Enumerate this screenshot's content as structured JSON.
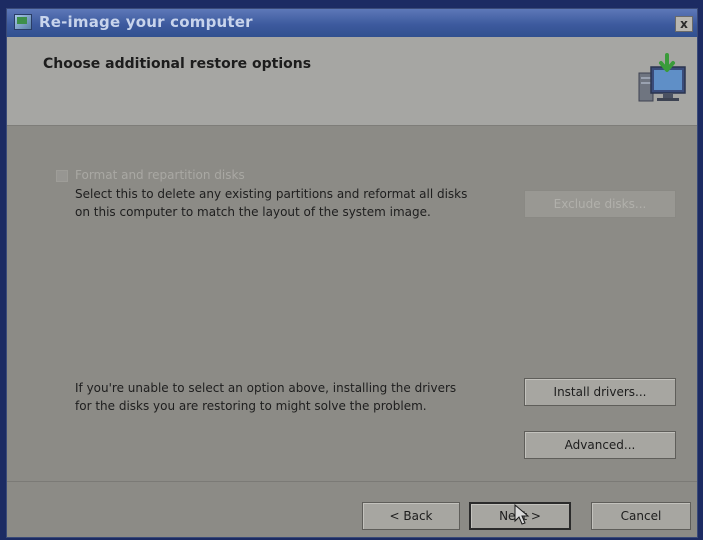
{
  "window": {
    "title": "Re-image your computer",
    "close_glyph": "x"
  },
  "header": {
    "title": "Choose additional restore options",
    "icon": "computer-restore-icon"
  },
  "format_option": {
    "checkbox_label": "Format and repartition disks",
    "checked": false,
    "enabled": false,
    "description_line1": "Select this to delete any existing partitions and reformat all disks",
    "description_line2": "on this computer to match the layout of the system image.",
    "exclude_button_label": "Exclude disks..."
  },
  "drivers_option": {
    "description_line1": "If you're unable to select an option above, installing the drivers",
    "description_line2": "for the disks you are restoring to might solve the problem.",
    "install_button_label": "Install drivers...",
    "advanced_button_label": "Advanced..."
  },
  "footer": {
    "back_label": "< Back",
    "next_label": "Next >",
    "cancel_label": "Cancel"
  },
  "colors": {
    "titlebar": "#3d5a9e",
    "dialog_bg": "#8c8b86",
    "header_bg": "#a6a6a3",
    "desktop": "#1c2b63"
  }
}
